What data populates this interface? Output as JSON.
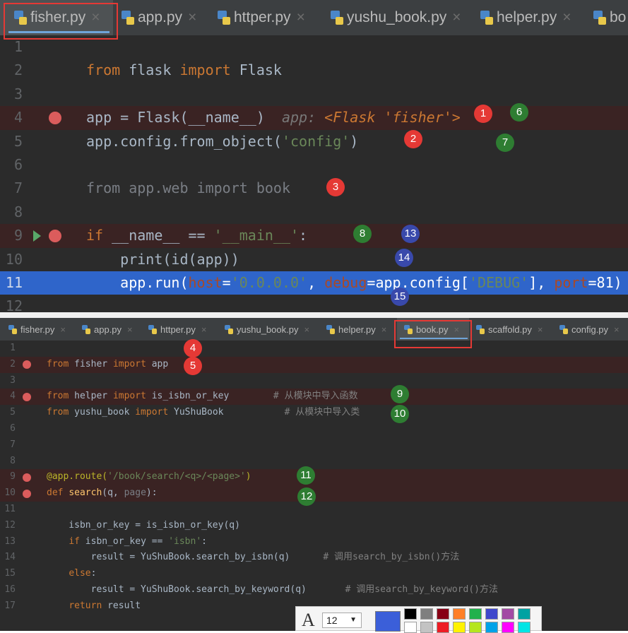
{
  "panel1": {
    "tabs": [
      {
        "label": "fisher.py",
        "active": true
      },
      {
        "label": "app.py",
        "active": false
      },
      {
        "label": "httper.py",
        "active": false
      },
      {
        "label": "yushu_book.py",
        "active": false
      },
      {
        "label": "helper.py",
        "active": false
      },
      {
        "label": "bo",
        "active": false
      }
    ],
    "close_glyph": "×",
    "lines": [
      {
        "num": "1"
      },
      {
        "num": "2",
        "code": [
          [
            "kw",
            "from "
          ],
          [
            "plain",
            "flask "
          ],
          [
            "kw",
            "import "
          ],
          [
            "plain",
            "Flask"
          ]
        ]
      },
      {
        "num": "3"
      },
      {
        "num": "4",
        "breakpoint": true,
        "highlight": "red",
        "code": [
          [
            "plain",
            "app = Flask(__name__)  "
          ],
          [
            "hintlbl",
            "app: "
          ],
          [
            "hint",
            "<Flask 'fisher'>"
          ]
        ]
      },
      {
        "num": "5",
        "code": [
          [
            "plain",
            "app.config.from_object("
          ],
          [
            "str",
            "'config'"
          ],
          [
            "plain",
            ")"
          ]
        ]
      },
      {
        "num": "6"
      },
      {
        "num": "7",
        "code": [
          [
            "dim",
            "from app.web import book"
          ]
        ]
      },
      {
        "num": "8"
      },
      {
        "num": "9",
        "breakpoint": true,
        "run_arrow": true,
        "highlight": "red",
        "code": [
          [
            "kw",
            "if "
          ],
          [
            "plain",
            "__name__ == "
          ],
          [
            "str",
            "'__main__'"
          ],
          [
            "plain",
            ":"
          ]
        ]
      },
      {
        "num": "10",
        "code": [
          [
            "plain",
            "    print(id(app))"
          ]
        ]
      },
      {
        "num": "11",
        "highlight": "blue",
        "code": [
          [
            "plain",
            "    app.run("
          ],
          [
            "param",
            "host"
          ],
          [
            "plain",
            "="
          ],
          [
            "str",
            "'0.0.0.0'"
          ],
          [
            "plain",
            ", "
          ],
          [
            "param",
            "debug"
          ],
          [
            "plain",
            "=app.config["
          ],
          [
            "str",
            "'DEBUG'"
          ],
          [
            "plain",
            "], "
          ],
          [
            "param",
            "port"
          ],
          [
            "plain",
            "=81)"
          ]
        ]
      },
      {
        "num": "12"
      }
    ],
    "badges": [
      {
        "label": "1",
        "color": "red"
      },
      {
        "label": "6",
        "color": "green"
      },
      {
        "label": "2",
        "color": "red"
      },
      {
        "label": "7",
        "color": "green"
      },
      {
        "label": "3",
        "color": "red"
      },
      {
        "label": "8",
        "color": "green"
      },
      {
        "label": "13",
        "color": "blue"
      },
      {
        "label": "14",
        "color": "blue"
      },
      {
        "label": "15",
        "color": "blue"
      }
    ]
  },
  "panel2": {
    "tabs": [
      {
        "label": "fisher.py",
        "active": false
      },
      {
        "label": "app.py",
        "active": false
      },
      {
        "label": "httper.py",
        "active": false
      },
      {
        "label": "yushu_book.py",
        "active": false
      },
      {
        "label": "helper.py",
        "active": false
      },
      {
        "label": "book.py",
        "active": true
      },
      {
        "label": "scaffold.py",
        "active": false
      },
      {
        "label": "config.py",
        "active": false
      }
    ],
    "lines": [
      {
        "num": "1"
      },
      {
        "num": "2",
        "breakpoint": true,
        "highlight": "red",
        "code": [
          [
            "kw",
            "from "
          ],
          [
            "plain",
            "fisher "
          ],
          [
            "kw",
            "import "
          ],
          [
            "plain",
            "app"
          ]
        ]
      },
      {
        "num": "3"
      },
      {
        "num": "4",
        "breakpoint": true,
        "highlight": "red",
        "code": [
          [
            "kw",
            "from "
          ],
          [
            "plain",
            "helper "
          ],
          [
            "kw",
            "import "
          ],
          [
            "plain",
            "is_isbn_or_key        "
          ],
          [
            "cm",
            "# 从模块中导入函数"
          ]
        ]
      },
      {
        "num": "5",
        "code": [
          [
            "kw",
            "from "
          ],
          [
            "plain",
            "yushu_book "
          ],
          [
            "kw",
            "import "
          ],
          [
            "plain",
            "YuShuBook           "
          ],
          [
            "cm",
            "# 从模块中导入类"
          ]
        ]
      },
      {
        "num": "6"
      },
      {
        "num": "7"
      },
      {
        "num": "8"
      },
      {
        "num": "9",
        "breakpoint": true,
        "highlight": "red",
        "code": [
          [
            "deco",
            "@app.route("
          ],
          [
            "str",
            "'/book/search/<q>/<page>'"
          ],
          [
            "deco",
            ")"
          ]
        ]
      },
      {
        "num": "10",
        "breakpoint": true,
        "highlight": "red",
        "code": [
          [
            "kw",
            "def "
          ],
          [
            "fn",
            "search"
          ],
          [
            "plain",
            "(q, "
          ],
          [
            "dim",
            "page"
          ],
          [
            "plain",
            "):"
          ]
        ]
      },
      {
        "num": "11"
      },
      {
        "num": "12",
        "code": [
          [
            "plain",
            "    isbn_or_key = is_isbn_or_key(q)"
          ]
        ]
      },
      {
        "num": "13",
        "code": [
          [
            "plain",
            "    "
          ],
          [
            "kw",
            "if "
          ],
          [
            "plain",
            "isbn_or_key == "
          ],
          [
            "str",
            "'isbn'"
          ],
          [
            "plain",
            ":"
          ]
        ]
      },
      {
        "num": "14",
        "code": [
          [
            "plain",
            "        result = YuShuBook.search_by_isbn(q)      "
          ],
          [
            "cm",
            "# 调用search_by_isbn()方法"
          ]
        ]
      },
      {
        "num": "15",
        "code": [
          [
            "plain",
            "    "
          ],
          [
            "kw",
            "else"
          ],
          [
            "plain",
            ":"
          ]
        ]
      },
      {
        "num": "16",
        "code": [
          [
            "plain",
            "        result = YuShuBook.search_by_keyword(q)       "
          ],
          [
            "cm",
            "# 调用search_by_keyword()方法"
          ]
        ]
      },
      {
        "num": "17",
        "code": [
          [
            "plain",
            "    "
          ],
          [
            "kw",
            "return "
          ],
          [
            "plain",
            "result"
          ]
        ]
      }
    ],
    "badges": [
      {
        "label": "4",
        "color": "red"
      },
      {
        "label": "5",
        "color": "red"
      },
      {
        "label": "9",
        "color": "green"
      },
      {
        "label": "10",
        "color": "green"
      },
      {
        "label": "11",
        "color": "green"
      },
      {
        "label": "12",
        "color": "green"
      }
    ]
  },
  "palette": {
    "font_glyph": "A",
    "font_size": "12",
    "dropdown_glyph": "▼",
    "selected_color": "#3b5fd9",
    "colors_top": [
      "#000000",
      "#7f7f7f",
      "#880015",
      "#ff7f27",
      "#22b14c",
      "#3f48cc",
      "#a349a4",
      "#00a2a2"
    ],
    "colors_bottom": [
      "#ffffff",
      "#c3c3c3",
      "#ed1c24",
      "#fff200",
      "#b5e61d",
      "#00a2e8",
      "#ff00ff",
      "#00e5e5"
    ]
  },
  "badge_colors": {
    "red": "#e53935",
    "green": "#2e7d32",
    "blue": "#3949ab"
  }
}
